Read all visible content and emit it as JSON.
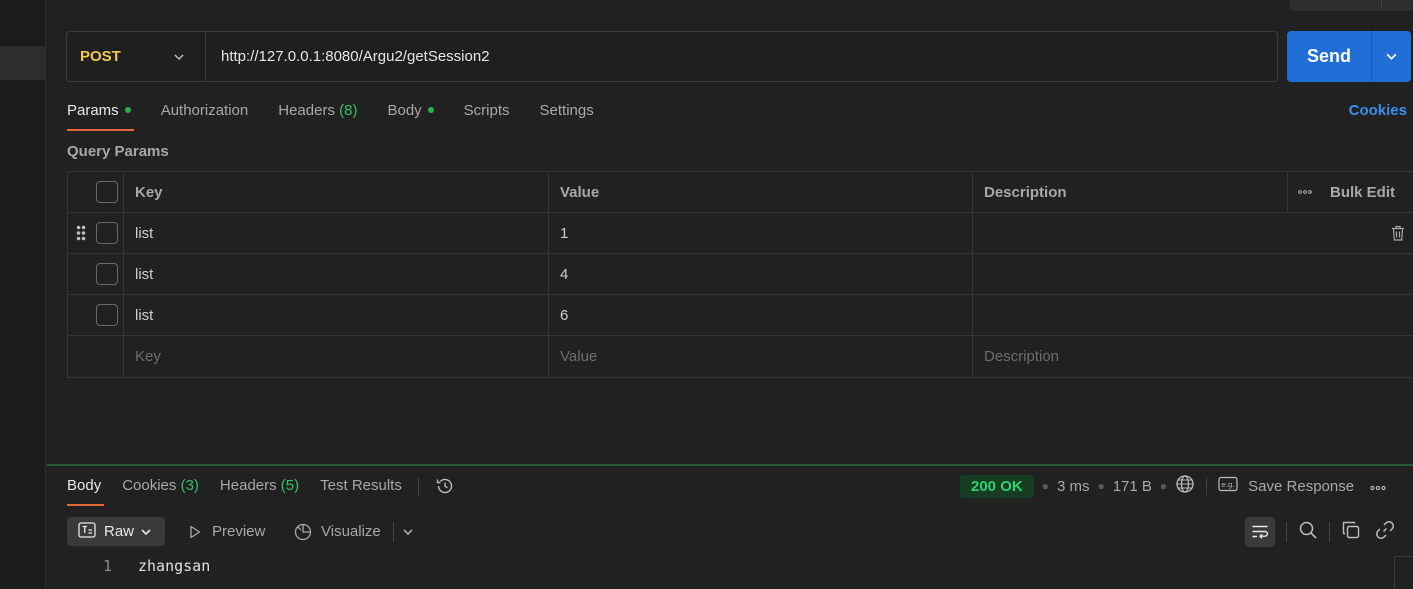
{
  "request": {
    "method": "POST",
    "url": "http://127.0.0.1:8080/Argu2/getSession2",
    "send_label": "Send"
  },
  "request_tabs": [
    {
      "label": "Params",
      "dot": true,
      "count": "",
      "active": true
    },
    {
      "label": "Authorization",
      "dot": false,
      "count": "",
      "active": false
    },
    {
      "label": "Headers",
      "dot": false,
      "count": "(8)",
      "active": false
    },
    {
      "label": "Body",
      "dot": true,
      "count": "",
      "active": false
    },
    {
      "label": "Scripts",
      "dot": false,
      "count": "",
      "active": false
    },
    {
      "label": "Settings",
      "dot": false,
      "count": "",
      "active": false
    }
  ],
  "cookies_link": "Cookies",
  "query_params": {
    "title": "Query Params",
    "headers": {
      "key": "Key",
      "value": "Value",
      "description": "Description",
      "bulk_edit": "Bulk Edit"
    },
    "rows": [
      {
        "key": "list",
        "value": "1",
        "description": "",
        "checked": false
      },
      {
        "key": "list",
        "value": "4",
        "description": "",
        "checked": false
      },
      {
        "key": "list",
        "value": "6",
        "description": "",
        "checked": false
      }
    ],
    "placeholders": {
      "key": "Key",
      "value": "Value",
      "description": "Description"
    }
  },
  "response": {
    "tabs": [
      {
        "label": "Body",
        "count": "",
        "active": true
      },
      {
        "label": "Cookies",
        "count": "(3)",
        "active": false
      },
      {
        "label": "Headers",
        "count": "(5)",
        "active": false
      },
      {
        "label": "Test Results",
        "count": "",
        "active": false
      }
    ],
    "status": "200 OK",
    "time": "3 ms",
    "size": "171 B",
    "save_response": "Save Response",
    "format": "Raw",
    "preview": "Preview",
    "visualize": "Visualize",
    "body_lines": [
      {
        "num": "1",
        "text": "zhangsan"
      }
    ]
  },
  "colors": {
    "method": "#f2c94c",
    "send": "#1f6fd6",
    "accent": "#e2673a",
    "status_ok": "#2fd16a",
    "link": "#3b8ef0"
  }
}
